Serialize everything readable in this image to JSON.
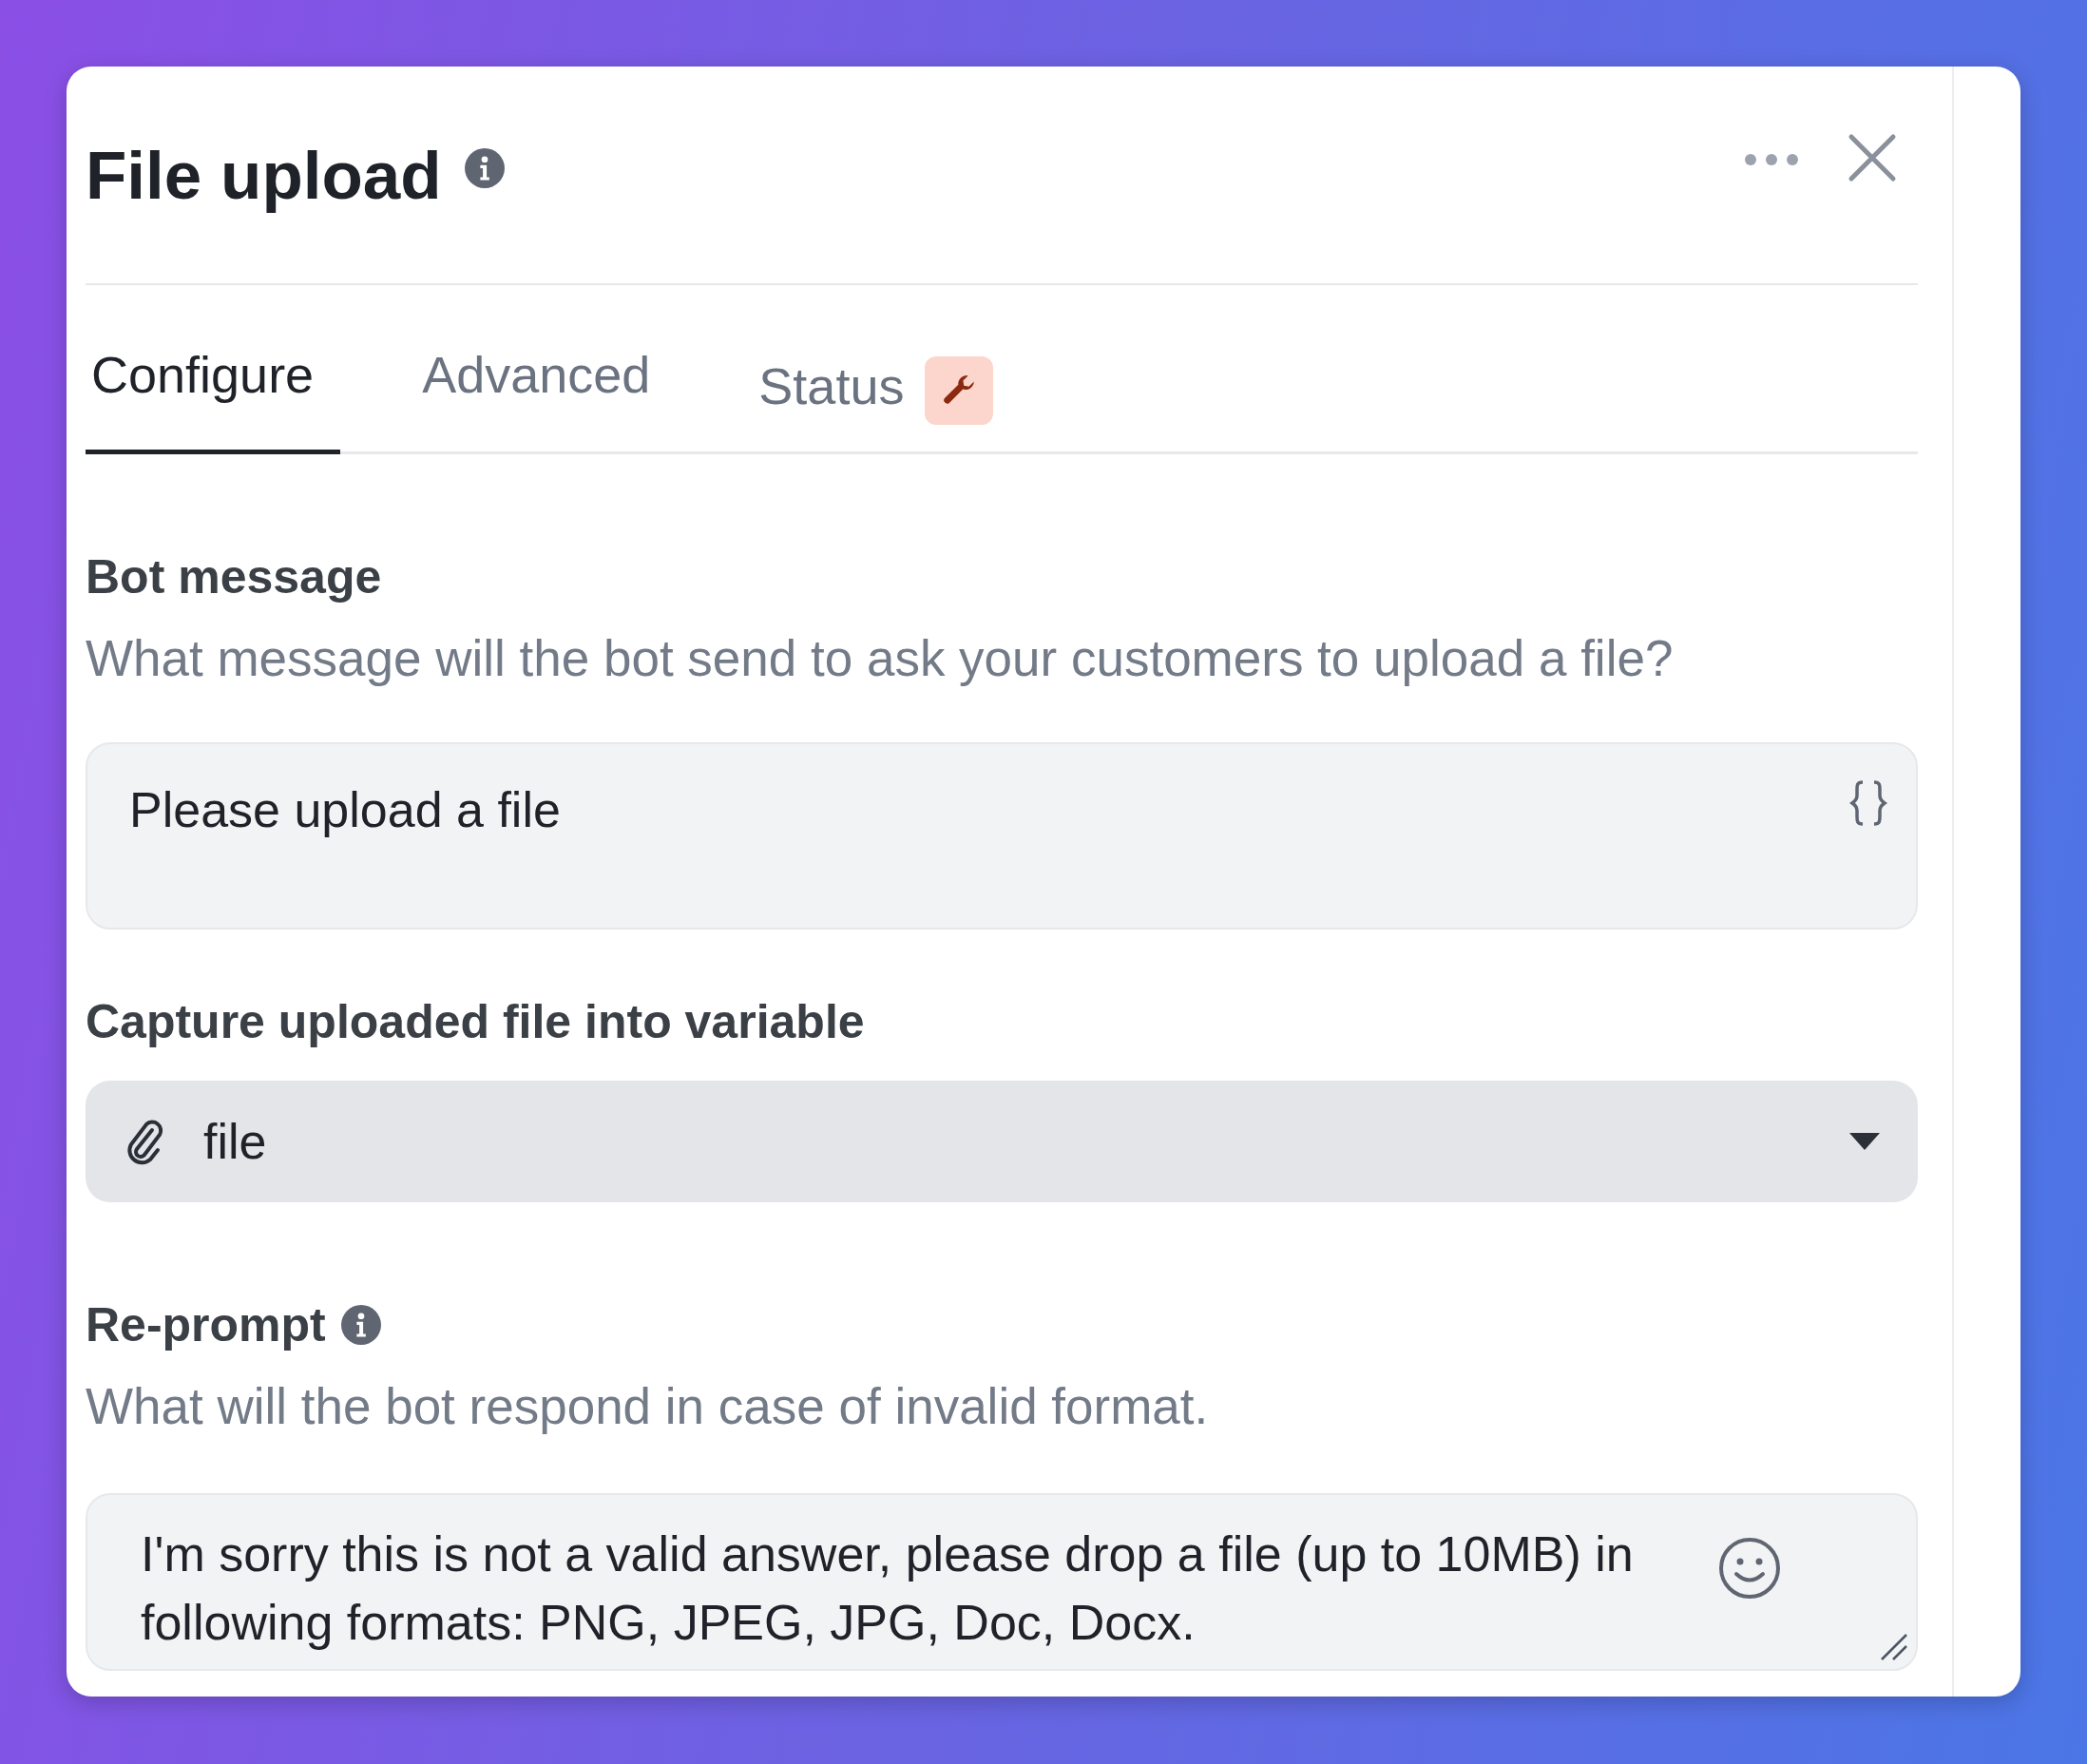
{
  "dialog": {
    "title": "File upload",
    "title_info": true,
    "tabs": [
      {
        "label": "Configure",
        "selected": true
      },
      {
        "label": "Advanced",
        "selected": false
      },
      {
        "label": "Status",
        "selected": false,
        "badge": true
      }
    ],
    "fields": [
      {
        "kind": "message",
        "label": "Bot message",
        "description": "What message will the bot send to ask your customers to upload a file?",
        "value": "Please upload a file"
      },
      {
        "kind": "select",
        "label": "Capture uploaded file into variable",
        "value": "file"
      },
      {
        "kind": "textarea",
        "label": "Re-prompt",
        "info": true,
        "description": "What will the bot respond in case of invalid format.",
        "value": "I'm sorry this is not a valid answer, please drop a file (up to 10MB) in following formats: PNG, JPEG, JPG, Doc, Docx."
      }
    ]
  }
}
